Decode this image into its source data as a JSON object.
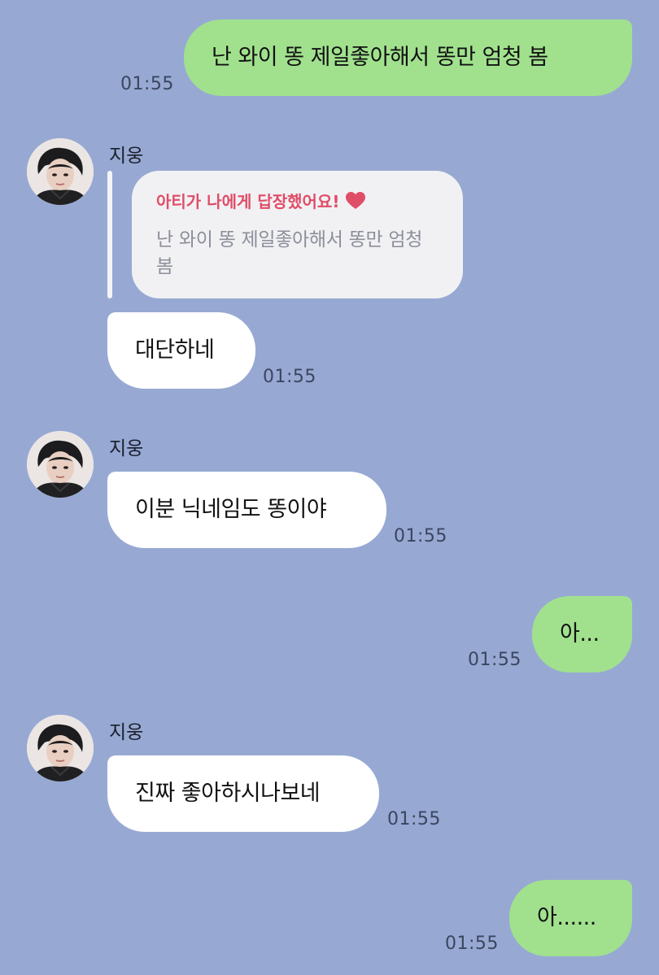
{
  "messages": {
    "m1": {
      "text": "난 와이 똥 제일좋아해서 똥만 엄청 봄",
      "time": "01:55"
    },
    "m2": {
      "sender": "지웅",
      "reply_title": "아티가 나에게 답장했어요!",
      "reply_quote": "난 와이 똥 제일좋아해서 똥만 엄청 봄",
      "text": "대단하네",
      "time": "01:55"
    },
    "m3": {
      "sender": "지웅",
      "text": "이분 닉네임도 똥이야",
      "time": "01:55"
    },
    "m4": {
      "text": "아...",
      "time": "01:55"
    },
    "m5": {
      "sender": "지웅",
      "text": "진짜 좋아하시나보네",
      "time": "01:55"
    },
    "m6": {
      "text": "아......",
      "time": "01:55"
    }
  },
  "colors": {
    "background": "#97a9d3",
    "outgoing_bubble": "#a1e18e",
    "incoming_bubble": "#ffffff",
    "reply_title": "#e04d67",
    "heart": "#e04d67"
  },
  "icons": {
    "reply_heart": "heart-icon",
    "avatar": "profile-photo"
  }
}
